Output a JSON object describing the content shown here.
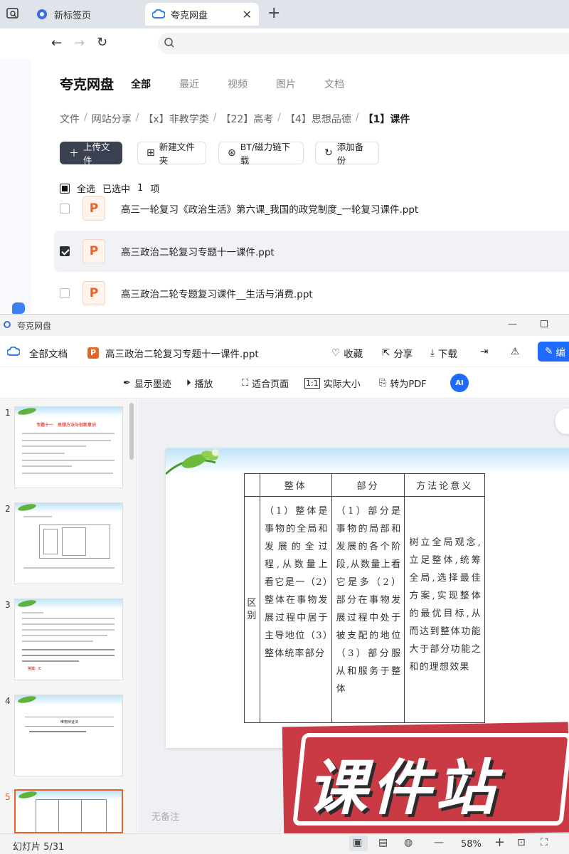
{
  "browser": {
    "tabs": [
      {
        "label": "新标签页"
      },
      {
        "label": "夸克网盘"
      }
    ],
    "new_tab": "+",
    "close": "✕"
  },
  "disk": {
    "brand": "夸克网盘",
    "nav": [
      "全部",
      "最近",
      "视频",
      "图片",
      "文档"
    ],
    "breadcrumb": [
      "文件",
      "网站分享",
      "【x】非教学类",
      "【22】高考",
      "【4】思想品德",
      "【1】课件"
    ],
    "buttons": {
      "upload": "上传文件",
      "new_folder": "新建文件夹",
      "bt": "BT/磁力链下载",
      "backup": "添加备份"
    },
    "select_all": "全选",
    "selected_text": "已选中",
    "selected_count": "1",
    "selected_unit": "项",
    "files": [
      {
        "name": "高三一轮复习《政治生活》第六课_我国的政党制度_一轮复习课件.ppt",
        "checked": false
      },
      {
        "name": "高三政治二轮复习专题十一课件.ppt",
        "checked": true
      },
      {
        "name": "高三政治二轮专题复习课件__生活与消费.ppt",
        "checked": false
      }
    ]
  },
  "viewer": {
    "window_title": "夸克网盘",
    "all_docs": "全部文档",
    "file_name": "高三政治二轮复习专题十一课件.ppt",
    "actions": {
      "favorite": "收藏",
      "share": "分享",
      "download": "下载",
      "edit": "编"
    },
    "toolbar": {
      "show_ink": "显示墨迹",
      "play": "播放",
      "fit_page": "适合页面",
      "actual_size": "实际大小",
      "to_pdf": "转为PDF",
      "ai": "AI"
    },
    "thumb_numbers": [
      "1",
      "2",
      "3",
      "4",
      "5"
    ],
    "thumb_titles": {
      "t1": "专题十一　思想方法与创新意识",
      "t4": "唯物辩证法",
      "answer": "答案：C"
    },
    "slide_table": {
      "headers": [
        "整体",
        "部分",
        "方法论意义"
      ],
      "row_head": "区别",
      "whole": "（1）整体是事物的全局和发展的全过程,从数量上看它是一（2）整体在事物发展过程中居于主导地位（3）整体统率部分",
      "part": "（1）部分是事物的局部和发展的各个阶段,从数量上看它是多（2）部分在事物发展过程中处于被支配的地位（3）部分服从和服务于整体",
      "method": "树立全局观念,立足整体,统筹全局,选择最佳方案,实现整体的最优目标,从而达到整体功能大于部分功能之和的理想效果"
    },
    "no_note": "无备注",
    "watermark": "课件站",
    "status": {
      "slide_counter": "幻灯片 5/31",
      "zoom": "58%"
    }
  }
}
